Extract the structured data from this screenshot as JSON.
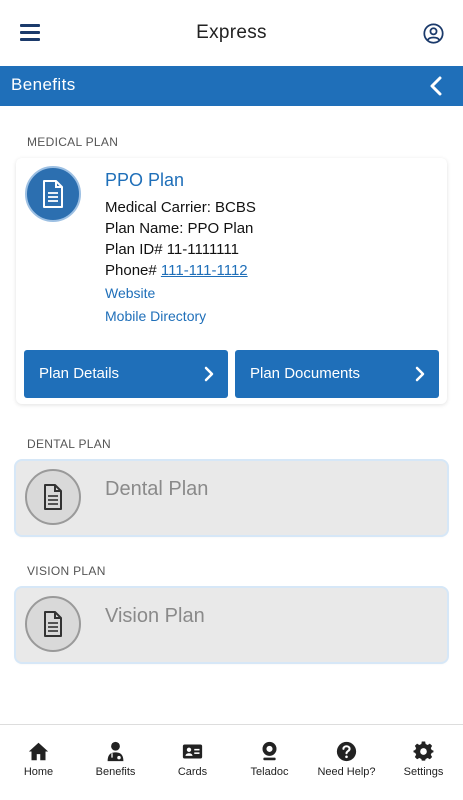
{
  "header": {
    "title": "Express"
  },
  "section_bar": {
    "label": "Benefits"
  },
  "medical": {
    "section_label": "MEDICAL PLAN",
    "plan_title": "PPO Plan",
    "carrier": "Medical Carrier: BCBS",
    "plan_name": "Plan Name: PPO Plan",
    "plan_id": "Plan ID# 11-1111111",
    "phone_prefix": "Phone# ",
    "phone": "111-111-1112",
    "website": "Website",
    "mobile_directory": "Mobile Directory",
    "plan_details_label": "Plan Details",
    "plan_documents_label": "Plan Documents"
  },
  "dental": {
    "section_label": "DENTAL PLAN",
    "title": "Dental Plan"
  },
  "vision": {
    "section_label": "VISION PLAN",
    "title": "Vision Plan"
  },
  "nav": {
    "items": [
      {
        "label": "Home",
        "icon": "home-icon"
      },
      {
        "label": "Benefits",
        "icon": "doctor-icon"
      },
      {
        "label": "Cards",
        "icon": "id-card-icon"
      },
      {
        "label": "Teladoc",
        "icon": "webcam-icon"
      },
      {
        "label": "Need Help?",
        "icon": "question-icon"
      },
      {
        "label": "Settings",
        "icon": "gear-icon"
      }
    ]
  },
  "colors": {
    "brand_blue": "#1f6fb9",
    "nav_dark": "#1b3a6b",
    "disabled_gray": "#e9e9e9"
  }
}
